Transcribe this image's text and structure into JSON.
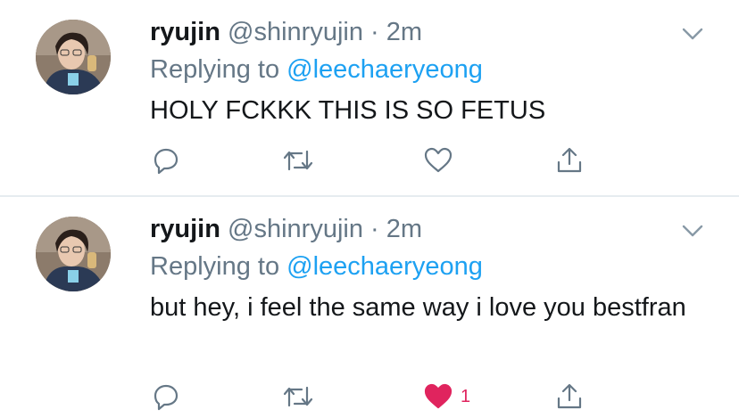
{
  "tweets": [
    {
      "display_name": "ryujin",
      "handle": "@shinryujin",
      "dot": "·",
      "time": "2m",
      "replying_prefix": "Replying to ",
      "replying_to": "@leechaeryeong",
      "text": "HOLY FCKKK THIS IS SO FETUS",
      "liked": false,
      "like_count": ""
    },
    {
      "display_name": "ryujin",
      "handle": "@shinryujin",
      "dot": "·",
      "time": "2m",
      "replying_prefix": "Replying to ",
      "replying_to": "@leechaeryeong",
      "text": "but hey, i feel the same way i love you bestfran",
      "liked": true,
      "like_count": "1"
    }
  ],
  "icons": {
    "reply": "reply-icon",
    "retweet": "retweet-icon",
    "like": "heart-icon",
    "share": "share-icon",
    "menu": "chevron-down-icon"
  },
  "colors": {
    "text": "#14171a",
    "secondary": "#657786",
    "link": "#1da1f2",
    "like_active": "#e0245e",
    "divider": "#e6ecf0"
  }
}
